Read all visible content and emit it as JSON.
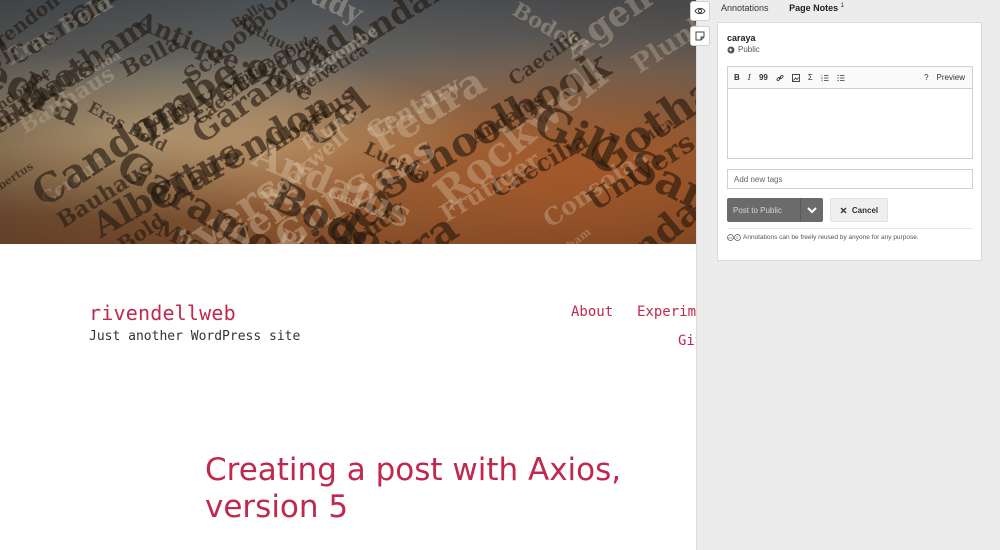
{
  "site": {
    "title": "rivendellweb",
    "tagline": "Just another WordPress site",
    "nav": [
      "About",
      "Experiments",
      "GitHub"
    ],
    "post_title": "Creating a post with Axios, version 5"
  },
  "hero_words": [
    "Gotham",
    "Fedra",
    "Mica",
    "Gel",
    "Plunk",
    "Eras Bold",
    "Bauhaus",
    "Univers",
    "Caecilia",
    "Candombe",
    "Albertus",
    "Antique Olive",
    "Agenda",
    "Andalus",
    "Frutiger",
    "Century",
    "Schoolbook",
    "Clarendon",
    "Garamond",
    "Consolas",
    "Courier",
    "Bodoni",
    "Bella",
    "Gill Sans",
    "Helvetica",
    "Lucida",
    "Goudy",
    "Rockwell"
  ],
  "hypothesis": {
    "tabs": [
      {
        "label": "Annotations"
      },
      {
        "label": "Page Notes",
        "count": "1"
      }
    ],
    "card": {
      "user": "caraya",
      "privacy": "Public",
      "toolbar": [
        "B",
        "I",
        "99",
        "link",
        "image",
        "Σ",
        "numbered-list",
        "bullet-list"
      ],
      "help": "?",
      "preview": "Preview",
      "tags_placeholder": "Add new tags",
      "post_label": "Post to Public",
      "cancel_label": "Cancel",
      "license_text": "Annotations can be freely reused by anyone for any purpose."
    }
  },
  "colors": {
    "accent": "#c0294d",
    "sidebar_bg": "#ececec",
    "post_button": "#6b6b6b"
  }
}
